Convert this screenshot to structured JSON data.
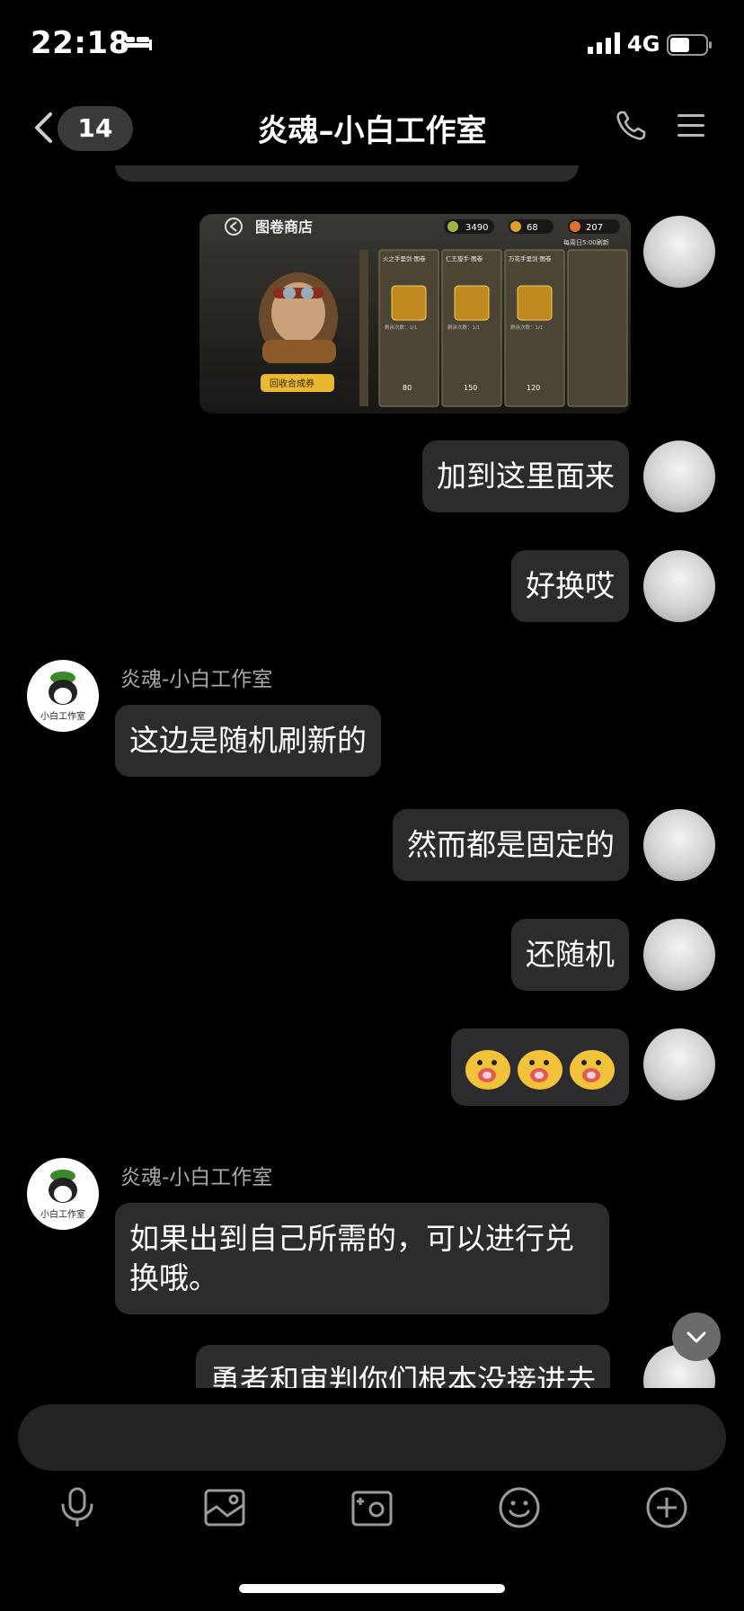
{
  "status_bar": {
    "time": "22:18",
    "network": "4G",
    "battery_level": 0.55
  },
  "header": {
    "unread_count": "14",
    "title": "炎魂–小白工作室"
  },
  "image_message": {
    "store_title": "图卷商店",
    "currency_1": "3490",
    "currency_2": "68",
    "currency_3": "207",
    "refresh_note": "每周日5:00刷新",
    "redeem_button": "回收合成券",
    "cards": [
      {
        "name": "火之手里剑·图卷",
        "remaining": "剩余次数：1/1",
        "price": "80"
      },
      {
        "name": "仁王旋手·图卷",
        "remaining": "剩余次数：1/1",
        "price": "150"
      },
      {
        "name": "万花手里剑·图卷",
        "remaining": "剩余次数：1/1",
        "price": "120"
      }
    ]
  },
  "messages": [
    {
      "side": "right",
      "text": "加到这里面来"
    },
    {
      "side": "right",
      "text": "好换哎"
    },
    {
      "side": "left",
      "sender": "炎魂-小白工作室",
      "text": "这边是随机刷新的"
    },
    {
      "side": "right",
      "text": "然而都是固定的"
    },
    {
      "side": "right",
      "text": "还随机"
    },
    {
      "side": "right",
      "type": "emoji",
      "emoji_icons": [
        "yellow-blob-emoji",
        "yellow-blob-emoji",
        "yellow-blob-emoji"
      ]
    },
    {
      "side": "left",
      "sender": "炎魂-小白工作室",
      "text": "如果出到自己所需的，可以进行兑换哦。"
    },
    {
      "side": "right",
      "text": "勇者和审判你们根本没接进去"
    }
  ],
  "studio_avatar_text": "小白工作室",
  "toolbar_icons": [
    "microphone-icon",
    "image-icon",
    "camera-icon",
    "emoji-icon",
    "plus-icon"
  ],
  "colors": {
    "background": "#000000",
    "bubble": "#2c2c2e",
    "sender_name": "#a8a8a8"
  }
}
